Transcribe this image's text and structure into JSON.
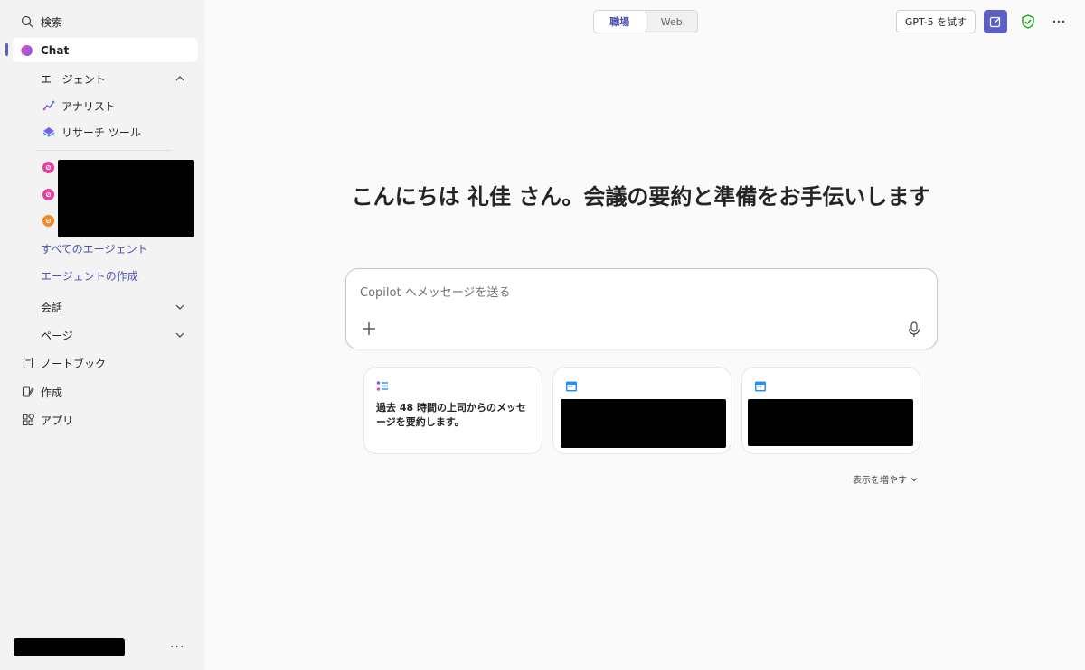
{
  "sidebar": {
    "search_label": "検索",
    "chat_label": "Chat",
    "agents_header": "エージェント",
    "agents": [
      {
        "label": "アナリスト",
        "icon": "analyst-icon"
      },
      {
        "label": "リサーチ ツール",
        "icon": "research-tool-icon"
      }
    ],
    "all_agents_link": "すべてのエージェント",
    "create_agent_link": "エージェントの作成",
    "conversations_label": "会話",
    "pages_label": "ページ",
    "notebook_label": "ノートブック",
    "create_label": "作成",
    "apps_label": "アプリ",
    "footer_more": "···"
  },
  "topbar": {
    "tab_work": "職場",
    "tab_web": "Web",
    "gpt_button": "GPT-5 を試す",
    "more": "···"
  },
  "main": {
    "greeting": "こんにちは 礼佳 さん。会議の要約と準備をお手伝いします",
    "prompt_placeholder": "Copilot へメッセージを送る",
    "cards": [
      {
        "text": "過去 48 時間の上司からのメッセージを要約します。"
      }
    ],
    "show_more": "表示を増やす"
  },
  "colors": {
    "accent": "#5b5fc7",
    "link": "#4f52b2",
    "shield": "#13a10e"
  }
}
